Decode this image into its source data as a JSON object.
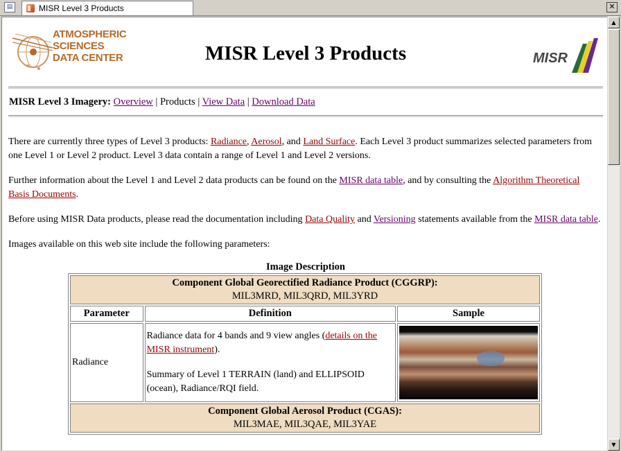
{
  "window": {
    "tab_title": "MISR Level 3 Products",
    "close_glyph": "✕"
  },
  "header": {
    "logo_asdc_line1": "ATMOSPHERIC",
    "logo_asdc_line2": "SCIENCES",
    "logo_asdc_line3": "DATA CENTER",
    "title": "MISR Level 3 Products",
    "logo_misr_text": "MISR"
  },
  "nav": {
    "label": "MISR Level 3 Imagery:",
    "overview": "Overview",
    "sep1": "|",
    "products": "Products",
    "sep2": "|",
    "view_data": "View Data",
    "sep3": "|",
    "download_data": "Download Data"
  },
  "body": {
    "p1": {
      "t1": "There are currently three types of Level 3 products: ",
      "link_radiance": "Radiance",
      "t2": ", ",
      "link_aerosol": "Aerosol",
      "t3": ", and ",
      "link_land": "Land Surface",
      "t4": ". Each Level 3 product summarizes selected parameters from one Level 1 or Level 2 product. Level 3 data contain a range of Level 1 and Level 2 versions."
    },
    "p2": {
      "t1": "Further information about the Level 1 and Level 2 data products can be found on the ",
      "link_misr_table": "MISR data table",
      "t2": ", and by consulting the ",
      "link_atbd": "Algorithm Theoretical Basis Documents",
      "t3": "."
    },
    "p3": {
      "t1": "Before using MISR Data products, please read the documentation including ",
      "link_quality": "Data Quality",
      "t2": " and ",
      "link_versioning": "Versioning",
      "t3": " statements available from the ",
      "link_misr_table": "MISR data table",
      "t4": "."
    },
    "p4": "Images available on this web site include the following parameters:"
  },
  "table": {
    "caption": "Image Description",
    "section1_title": "Component Global Georectified Radiance Product (CGGRP):",
    "section1_codes": "MIL3MRD, MIL3QRD, MIL3YRD",
    "col_parameter": "Parameter",
    "col_definition": "Definition",
    "col_sample": "Sample",
    "row1_parameter": "Radiance",
    "row1_def_t1": "Radiance data for 4 bands and 9 view angles (",
    "row1_def_link": "details on the MISR instrument",
    "row1_def_t2": ").",
    "row1_def_p2": "Summary of Level 1 TERRAIN (land) and ELLIPSOID (ocean), Radiance/RQI field.",
    "section2_title": "Component Global Aerosol Product (CGAS):",
    "section2_codes": "MIL3MAE, MIL3QAE, MIL3YAE"
  },
  "scrollbar": {
    "up_glyph": "▲",
    "down_glyph": "▼"
  },
  "colors": {
    "link": "#990000",
    "visited_link": "#660066",
    "table_band": "#f0dcc0",
    "asdc_logo": "#b56a2a"
  }
}
